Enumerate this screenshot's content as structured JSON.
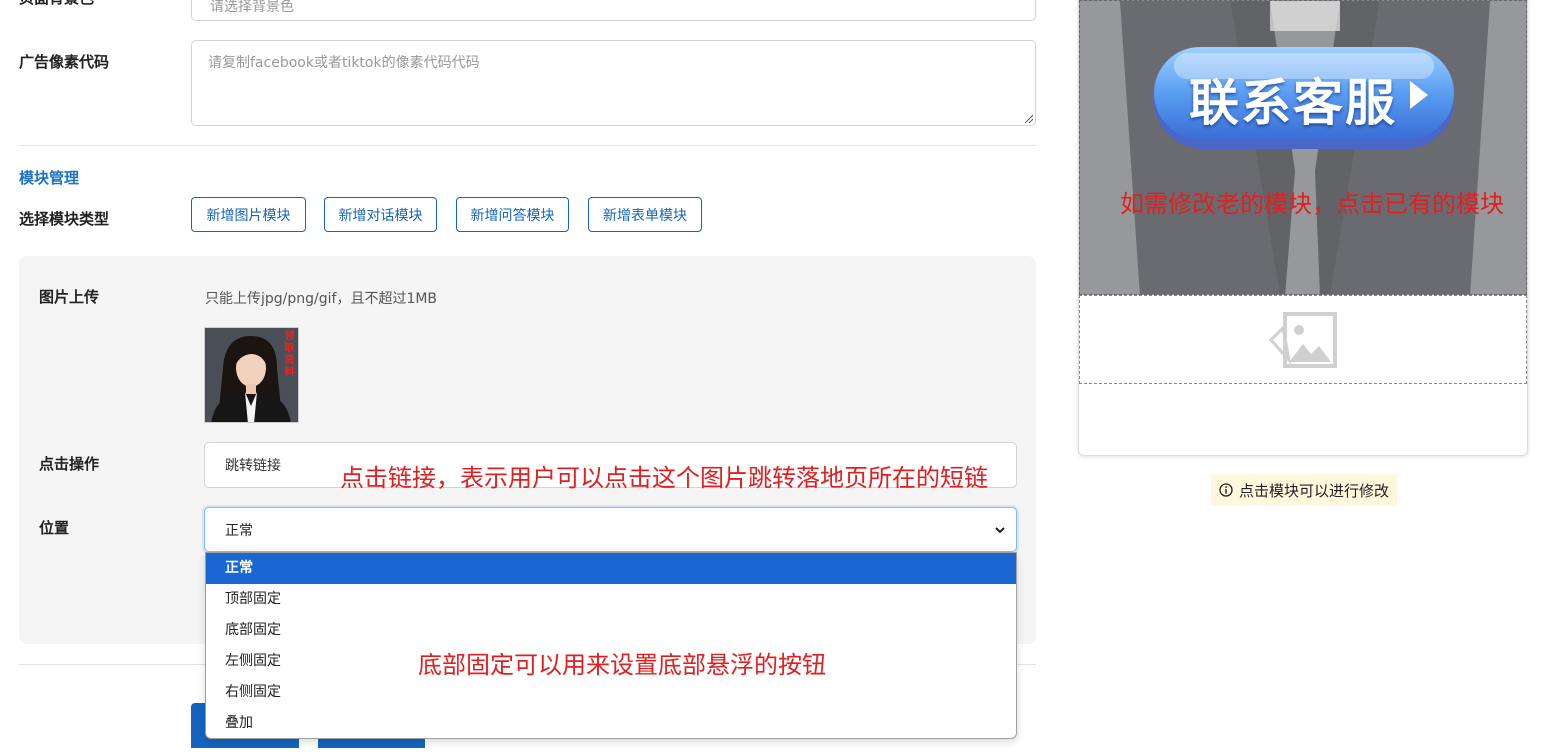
{
  "form": {
    "bg_color_label": "页面背景色",
    "bg_color_placeholder": "请选择背景色",
    "pixel_label": "广告像素代码",
    "pixel_placeholder": "请复制facebook或者tiktok的像素代码代码"
  },
  "modules": {
    "section_title": "模块管理",
    "type_label": "选择模块类型",
    "buttons": [
      "新增图片模块",
      "新增对话模块",
      "新增问答模块",
      "新增表单模块"
    ]
  },
  "image_module": {
    "upload_label": "图片上传",
    "upload_hint": "只能上传jpg/png/gif，且不超过1MB",
    "thumbnail_caption": "领取资料",
    "click_label": "点击操作",
    "click_value": "跳转链接",
    "position_label": "位置",
    "position_value": "正常",
    "position_options": [
      "正常",
      "顶部固定",
      "底部固定",
      "左侧固定",
      "右侧固定",
      "叠加"
    ]
  },
  "annotations": {
    "click_link": "点击链接，表示用户可以点击这个图片跳转落地页所在的短链",
    "bottom_fixed": "底部固定可以用来设置底部悬浮的按钮",
    "modify_module": "如需修改老的模块，点击已有的模块"
  },
  "preview": {
    "cta_text": "联系客服",
    "tip_icon": "info-icon",
    "tip_text": "点击模块可以进行修改"
  },
  "colors": {
    "primary": "#1565c0",
    "annotation": "#e02020",
    "section_title": "#1a73c8",
    "selected_option": "#1967d2"
  }
}
